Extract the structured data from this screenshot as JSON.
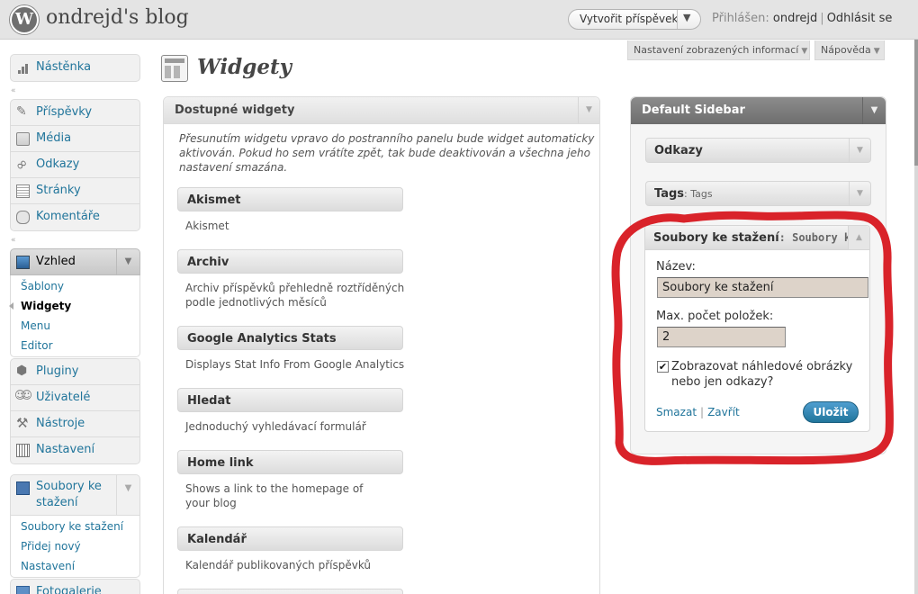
{
  "header": {
    "blog_title": "ondrejd's blog",
    "new_post": "Vytvořit příspěvek",
    "login_prefix": "Přihlášen:",
    "username": "ondrejd",
    "logout": "Odhlásit se"
  },
  "screen_meta": {
    "options": "Nastavení zobrazených informací",
    "help": "Nápověda"
  },
  "menu": {
    "dashboard": "Nástěnka",
    "posts": "Příspěvky",
    "media": "Média",
    "links": "Odkazy",
    "pages": "Stránky",
    "comments": "Komentáře",
    "appearance": "Vzhled",
    "appearance_sub": [
      "Šablony",
      "Widgety",
      "Menu",
      "Editor"
    ],
    "plugins": "Pluginy",
    "users": "Uživatelé",
    "tools": "Nástroje",
    "settings": "Nastavení",
    "downloads": "Soubory ke stažení",
    "downloads_sub": [
      "Soubory ke stažení",
      "Přidej nový",
      "Nastavení"
    ],
    "gallery": "Fotogalerie"
  },
  "page_title": "Widgety",
  "available": {
    "title": "Dostupné widgety",
    "description": "Přesunutím widgetu vpravo do postranního panelu bude widget automaticky aktivován. Pokud ho sem vrátíte zpět, tak bude deaktivován a všechna jeho nastavení smazána.",
    "widgets": [
      {
        "title": "Akismet",
        "desc": "Akismet"
      },
      {
        "title": "Archiv",
        "desc": "Archiv příspěvků přehledně roztříděných podle jednotlivých měsíců"
      },
      {
        "title": "Google Analytics Stats",
        "desc": "Displays Stat Info From Google Analytics"
      },
      {
        "title": "Hledat",
        "desc": "Jednoduchý vyhledávací formulář"
      },
      {
        "title": "Home link",
        "desc": "Shows a link to the homepage of your blog"
      },
      {
        "title": "Kalendář",
        "desc": "Kalendář publikovaných příspěvků"
      }
    ]
  },
  "sidebar": {
    "title": "Default Sidebar",
    "widgets": [
      {
        "title": "Odkazy",
        "subtitle": ""
      },
      {
        "title": "Tags",
        "subtitle": ": Tags"
      }
    ],
    "open_widget": {
      "title": "Soubory ke stažení",
      "subtitle": ": Soubory ke s",
      "name_label": "Název:",
      "name_value": "Soubory ke stažení",
      "max_label": "Max. počet položek:",
      "max_value": "2",
      "checkbox_label": "Zobrazovat náhledové obrázky nebo jen odkazy?",
      "checkbox_checked": true,
      "delete": "Smazat",
      "close": "Zavřít",
      "save": "Uložit"
    }
  },
  "colors": {
    "link": "#21759b",
    "annotation": "#d9232a",
    "save_button": "#21759b"
  }
}
